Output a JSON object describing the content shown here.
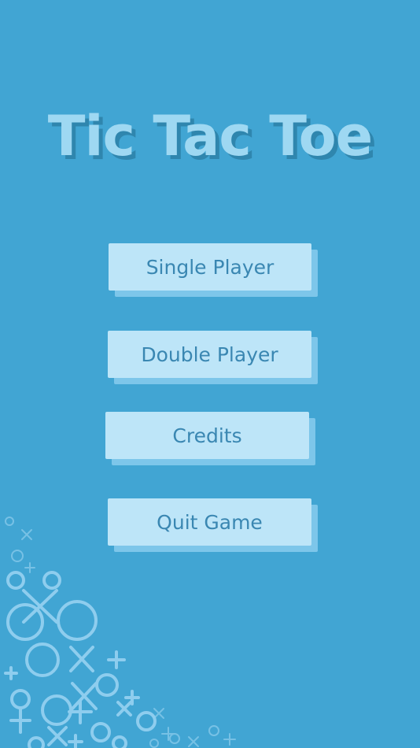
{
  "game": {
    "title": "Tic Tac Toe"
  },
  "menu": {
    "items": [
      {
        "label": "Single Player"
      },
      {
        "label": "Double Player"
      },
      {
        "label": "Credits"
      },
      {
        "label": "Quit Game"
      }
    ]
  },
  "decoration": {
    "icon": "x-and-o-pattern"
  },
  "colors": {
    "background": "#41A5D3",
    "button": "#BDE5F8",
    "button_shadow": "#7DC6EA",
    "button_text": "#3A87B2",
    "title_text": "#9ED8F2",
    "title_shadow": "#2F86AE"
  }
}
